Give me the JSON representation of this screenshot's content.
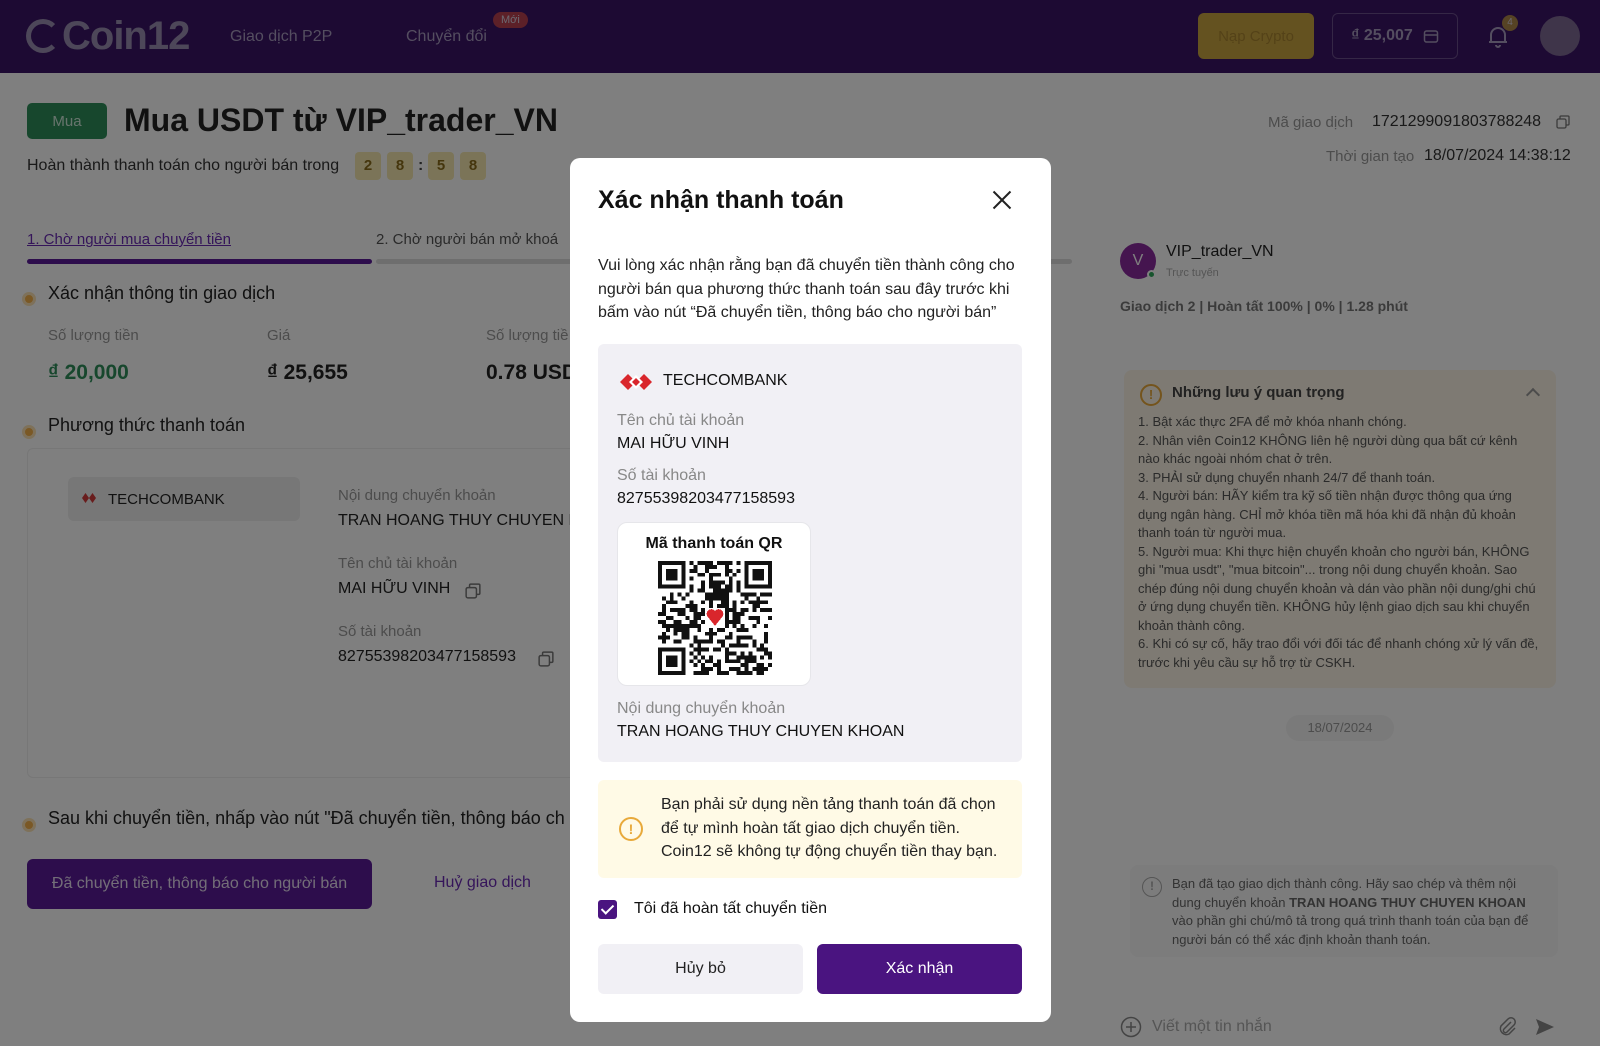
{
  "header": {
    "logo": "Coin12",
    "nav": [
      "Giao dịch P2P",
      "Chuyển đổi"
    ],
    "new_badge": "Mới",
    "deposit_label": "Nạp Crypto",
    "balance": "₫ 25,007",
    "notif_count": "4"
  },
  "page": {
    "tag": "Mua",
    "title": "Mua USDT từ VIP_trader_VN",
    "countdown_label": "Hoàn thành thanh toán cho người bán trong",
    "countdown": [
      "2",
      "8",
      "5",
      "8"
    ],
    "countdown_sep": ":",
    "tx_id_label": "Mã giao dịch",
    "tx_id": "1721299091803788248",
    "created_label": "Thời gian tạo",
    "created": "18/07/2024 14:38:12",
    "steps": [
      "1. Chờ người mua chuyển tiền",
      "2. Chờ người bán mở khoá"
    ],
    "section1": "Xác nhận thông tin giao dịch",
    "amount_label": "Số lượng tiền",
    "amount": "₫ 20,000",
    "price_label": "Giá",
    "price": "₫ 25,655",
    "qty_label": "Số lượng tiề",
    "qty": "0.78 USD",
    "section2": "Phương thức thanh toán",
    "bank": "TECHCOMBANK",
    "transfer_note_label": "Nội dung chuyển khoản",
    "transfer_note": "TRAN HOANG THUY CHUYEN K",
    "holder_label": "Tên chủ tài khoản",
    "holder": "MAI HỮU VINH",
    "account_label": "Số tài khoản",
    "account": "82755398203477158593",
    "section3": "Sau khi chuyển tiền, nhấp vào nút \"Đã chuyển tiền, thông báo ch",
    "sent_button": "Đã chuyển tiền, thông báo cho người bán",
    "cancel_tx": "Huỷ giao dịch"
  },
  "seller": {
    "avatar": "V",
    "name": "VIP_trader_VN",
    "status": "Trực tuyến",
    "stats": "Giao dịch  2  |  Hoàn tất  100%  |  0%  |  1.28 phút"
  },
  "notes": {
    "title": "Những lưu ý quan trọng",
    "items": [
      "1.  Bật xác thực 2FA để mở khóa nhanh chóng.",
      "2.  Nhân viên Coin12 KHÔNG liên hệ người dùng qua bất cứ kênh nào khác ngoài nhóm chat ở trên.",
      "3.  PHẢI sử dụng chuyển nhanh 24/7 để thanh toán.",
      "4.  Người bán: HÃY kiểm tra kỹ số tiền nhận được thông qua ứng dụng ngân hàng. CHỈ mở khóa tiền mã hóa khi đã nhận đủ khoản thanh toán từ người mua.",
      "5.  Người mua: Khi thực hiện chuyển khoản cho người bán, KHÔNG ghi \"mua usdt\", \"mua bitcoin\"... trong nội dung chuyển khoản. Sao chép đúng nội dung chuyển khoản và dán vào phần nội dung/ghi chú ở ứng dụng chuyển tiền. KHÔNG hủy lệnh giao dịch sau khi chuyển khoản thành công.",
      "6.  Khi có sự cố, hãy trao đổi với đối tác để nhanh chóng xử lý vấn đề, trước khi yêu cầu sự hỗ trợ từ CSKH."
    ]
  },
  "chat": {
    "date": "18/07/2024",
    "system_pre": "Bạn đã tạo giao dịch thành công. Hãy sao chép và thêm nội dung chuyển khoản ",
    "system_strong": "TRAN HOANG THUY CHUYEN KHOAN",
    "system_post": " vào phần ghi chú/mô tả trong quá trình thanh toán của bạn để người bán có thể xác định khoản thanh toán.",
    "input_placeholder": "Viết một tin nhắn"
  },
  "modal": {
    "title": "Xác nhận thanh toán",
    "description": "Vui lòng xác nhận rằng bạn đã chuyển tiền thành công cho người bán qua phương thức thanh toán sau đây trước khi bấm vào nút “Đã chuyển tiền, thông báo cho người bán”",
    "bank_name": "TECHCOMBANK",
    "holder_label": "Tên chủ tài khoản",
    "holder": "MAI HỮU VINH",
    "account_label": "Số tài khoản",
    "account": "82755398203477158593",
    "qr_title": "Mã thanh toán QR",
    "note_label": "Nội dung chuyển khoản",
    "note": "TRAN HOANG THUY CHUYEN KHOAN",
    "warning": "Bạn phải sử dụng nền tảng thanh toán đã chọn để tự mình hoàn tất giao dịch chuyển tiền. Coin12 sẽ không tự động chuyển tiền thay bạn.",
    "checkbox_label": "Tôi đã hoàn tất chuyển tiền",
    "checkbox_checked": true,
    "cancel_label": "Hủy bỏ",
    "confirm_label": "Xác nhận"
  },
  "colors": {
    "header_bg": "#3b1466",
    "primary": "#4a1480",
    "warning_bg": "#fffae6",
    "bank_box_bg": "#f1f0f5"
  },
  "icons": [
    "close-icon",
    "copy-icon",
    "bell-icon",
    "wallet-icon",
    "warning-icon",
    "info-icon",
    "thumb-up-icon",
    "clock-icon",
    "attach-icon",
    "send-icon",
    "add-icon",
    "qr-code-icon",
    "techcombank-logo-icon",
    "check-icon"
  ]
}
